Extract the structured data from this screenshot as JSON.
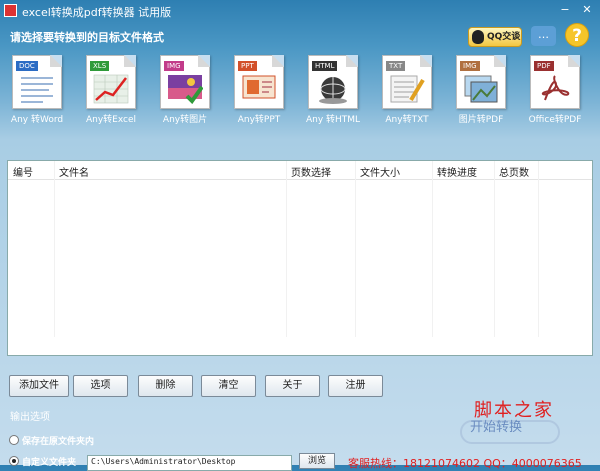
{
  "window": {
    "title": "excel转换成pdf转换器 试用版",
    "min_label": "−",
    "close_label": "✕"
  },
  "header": {
    "prompt": "请选择要转换到的目标文件格式",
    "qq_label": "QQ交谈",
    "chat_icon": "…",
    "help_icon": "?"
  },
  "formats": [
    {
      "tag": "DOC",
      "label": "Any 转Word",
      "tag_color": "#2b6cc4"
    },
    {
      "tag": "XLS",
      "label": "Any转Excel",
      "tag_color": "#2f9a3a"
    },
    {
      "tag": "IMG",
      "label": "Any转图片",
      "tag_color": "#c23b8a"
    },
    {
      "tag": "PPT",
      "label": "Any转PPT",
      "tag_color": "#d2502a"
    },
    {
      "tag": "HTML",
      "label": "Any 转HTML",
      "tag_color": "#333333"
    },
    {
      "tag": "TXT",
      "label": "Any转TXT",
      "tag_color": "#888888"
    },
    {
      "tag": "IMG",
      "label": "图片转PDF",
      "tag_color": "#b07040"
    },
    {
      "tag": "PDF",
      "label": "Office转PDF",
      "tag_color": "#9a3030"
    }
  ],
  "table": {
    "columns": [
      "编号",
      "文件名",
      "页数选择",
      "文件大小",
      "转换进度",
      "总页数"
    ]
  },
  "buttons": {
    "add": "添加文件",
    "options": "选项",
    "delete": "删除",
    "clear": "清空",
    "about": "关于",
    "register": "注册"
  },
  "output": {
    "title": "输出选项",
    "opt_same": "保存在原文件夹内",
    "opt_custom": "自定义文件夹",
    "path": "C:\\Users\\Administrator\\Desktop",
    "browse": "浏览",
    "hotline": "客服热线：18121074602 QQ：4000076365"
  },
  "watermark": {
    "main": "脚本之家",
    "sub": "开始转换"
  }
}
